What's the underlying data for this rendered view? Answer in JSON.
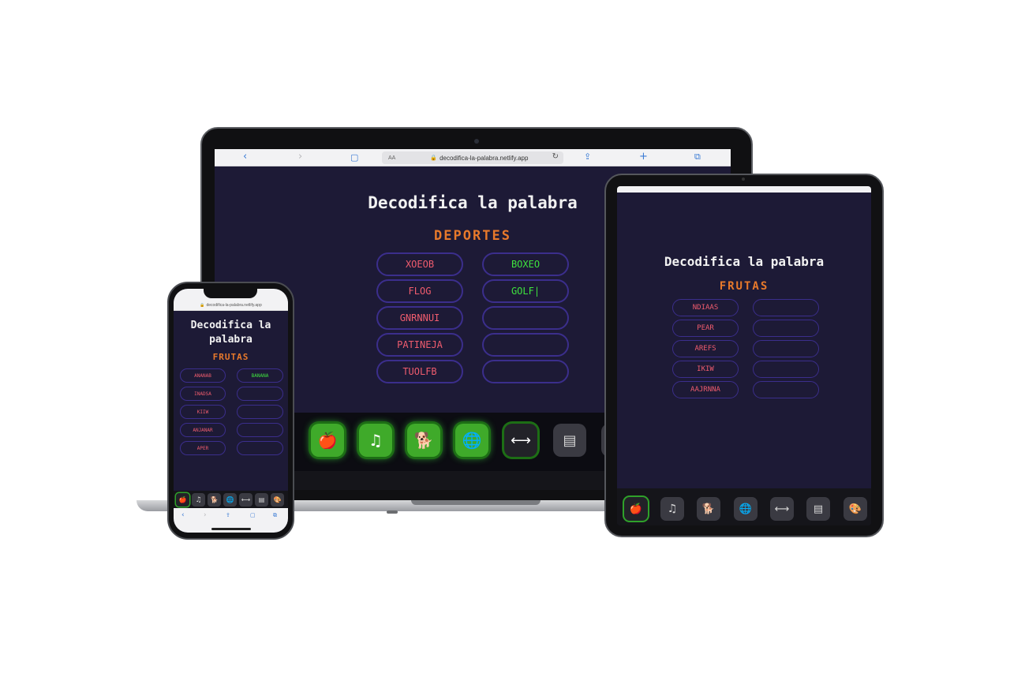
{
  "laptop": {
    "url": "decodifica-la-palabra.netlify.app",
    "url_prefix": "AA",
    "title": "Decodifica la palabra",
    "category": "DEPORTES",
    "scrambled": [
      "XOEOB",
      "FLOG",
      "GNRNNUI",
      "PATINEJA",
      "TUOLFB"
    ],
    "answers": [
      "BOXEO",
      "GOLF|",
      "",
      "",
      ""
    ]
  },
  "tablet": {
    "title": "Decodifica la palabra",
    "category": "FRUTAS",
    "scrambled": [
      "NDIAAS",
      "PEAR",
      "AREFS",
      "IKIW",
      "AAJRNNA"
    ],
    "answers": [
      "",
      "",
      "",
      "",
      ""
    ]
  },
  "phone": {
    "url": "decodifica-la-palabra.netlify.app",
    "title_line1": "Decodifica la",
    "title_line2": "palabra",
    "category": "FRUTAS",
    "scrambled": [
      "ANANAB",
      "INADSA",
      "KIIW",
      "ANJANAR",
      "APER"
    ],
    "answers": [
      "BANANA",
      "",
      "",
      "",
      ""
    ]
  },
  "icons": {
    "fruit": "🍎",
    "music": "♫",
    "animals": "🐕",
    "world": "🌐",
    "sports": "⟷",
    "id_card": "▤",
    "palette": "🎨"
  },
  "colors": {
    "background": "#1d1a36",
    "scrambled_text": "#ef5c6e",
    "answer_text": "#3ee23e",
    "category_text": "#e7792b",
    "box_border": "#3b2e8c",
    "active_icon": "#3faa2a"
  }
}
